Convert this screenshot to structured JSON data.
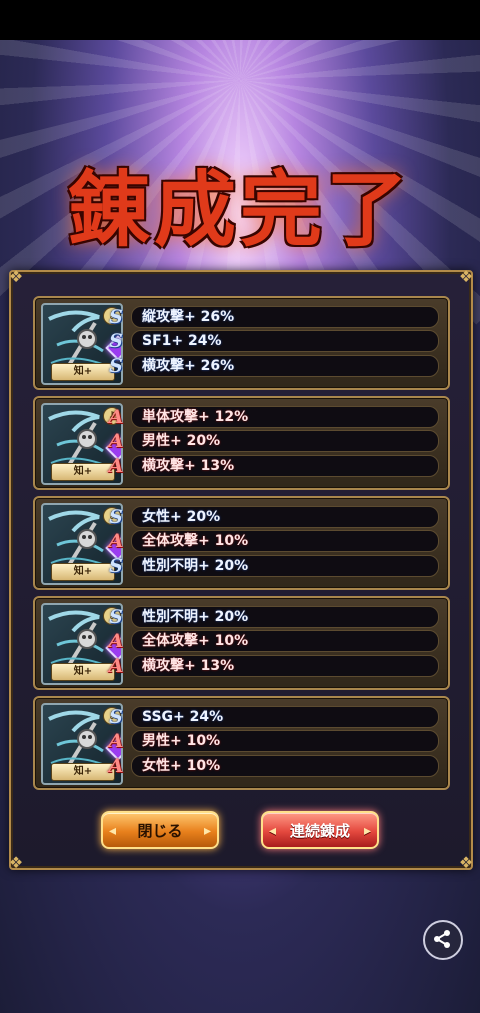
{
  "title": "錬成完了",
  "cards": [
    {
      "chip": "知+",
      "bonuses": [
        {
          "rank": "S",
          "text": "縦攻撃+ 26%"
        },
        {
          "rank": "S",
          "text": "SF1+ 24%"
        },
        {
          "rank": "S",
          "text": "横攻撃+ 26%"
        }
      ]
    },
    {
      "chip": "知+",
      "bonuses": [
        {
          "rank": "A",
          "text": "単体攻撃+ 12%"
        },
        {
          "rank": "A",
          "text": "男性+ 20%"
        },
        {
          "rank": "A",
          "text": "横攻撃+ 13%"
        }
      ]
    },
    {
      "chip": "知+",
      "bonuses": [
        {
          "rank": "S",
          "text": "女性+ 20%"
        },
        {
          "rank": "A",
          "text": "全体攻撃+ 10%"
        },
        {
          "rank": "S",
          "text": "性別不明+ 20%"
        }
      ]
    },
    {
      "chip": "知+",
      "bonuses": [
        {
          "rank": "S",
          "text": "性別不明+ 20%"
        },
        {
          "rank": "A",
          "text": "全体攻撃+ 10%"
        },
        {
          "rank": "A",
          "text": "横攻撃+ 13%"
        }
      ]
    },
    {
      "chip": "知+",
      "bonuses": [
        {
          "rank": "S",
          "text": "SSG+ 24%"
        },
        {
          "rank": "A",
          "text": "男性+ 10%"
        },
        {
          "rank": "A",
          "text": "女性+ 10%"
        }
      ]
    }
  ],
  "buttons": {
    "close": "閉じる",
    "continue": "連続錬成"
  },
  "icons": {
    "share": "share-icon",
    "key": "key-icon",
    "gem": "purple-gem-icon",
    "weapon": "scythe-weapon-icon"
  },
  "colors": {
    "frame_gold": "#b38b4a",
    "title_red": "#e03a1a",
    "s_rank": "#cfe3ff",
    "a_rank": "#ff8a86"
  }
}
